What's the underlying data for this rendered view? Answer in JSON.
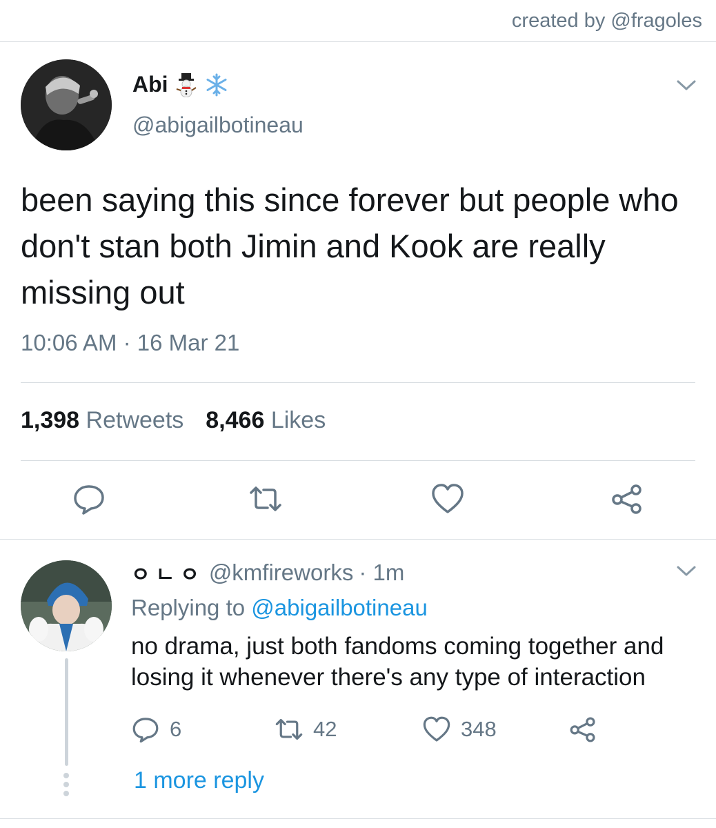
{
  "credit": "created by @fragoles",
  "tweet": {
    "name": "Abi",
    "name_emojis": [
      "snowman-icon",
      "snowflake-icon"
    ],
    "handle": "@abigailbotineau",
    "text": "been saying this since forever but people who don't stan both Jimin and Kook are really missing out",
    "time": "10:06 AM",
    "separator": "·",
    "date": "16 Mar 21",
    "retweets_count": "1,398",
    "retweets_label": "Retweets",
    "likes_count": "8,466",
    "likes_label": "Likes",
    "actions": [
      "reply-icon",
      "retweet-icon",
      "like-icon",
      "share-icon"
    ]
  },
  "reply": {
    "name": "ㅇㄴㅇ",
    "handle": "@kmfireworks",
    "time": "· 1m",
    "replying_prefix": "Replying to",
    "replying_to": "@abigailbotineau",
    "text": "no drama, just both fandoms coming together and losing it whenever there's any type of interaction",
    "reply_count": "6",
    "retweet_count": "42",
    "like_count": "348"
  },
  "more_replies": "1 more reply",
  "colors": {
    "text": "#14171a",
    "secondary": "#657786",
    "link": "#1b95e0",
    "divider": "#d8dde1"
  }
}
